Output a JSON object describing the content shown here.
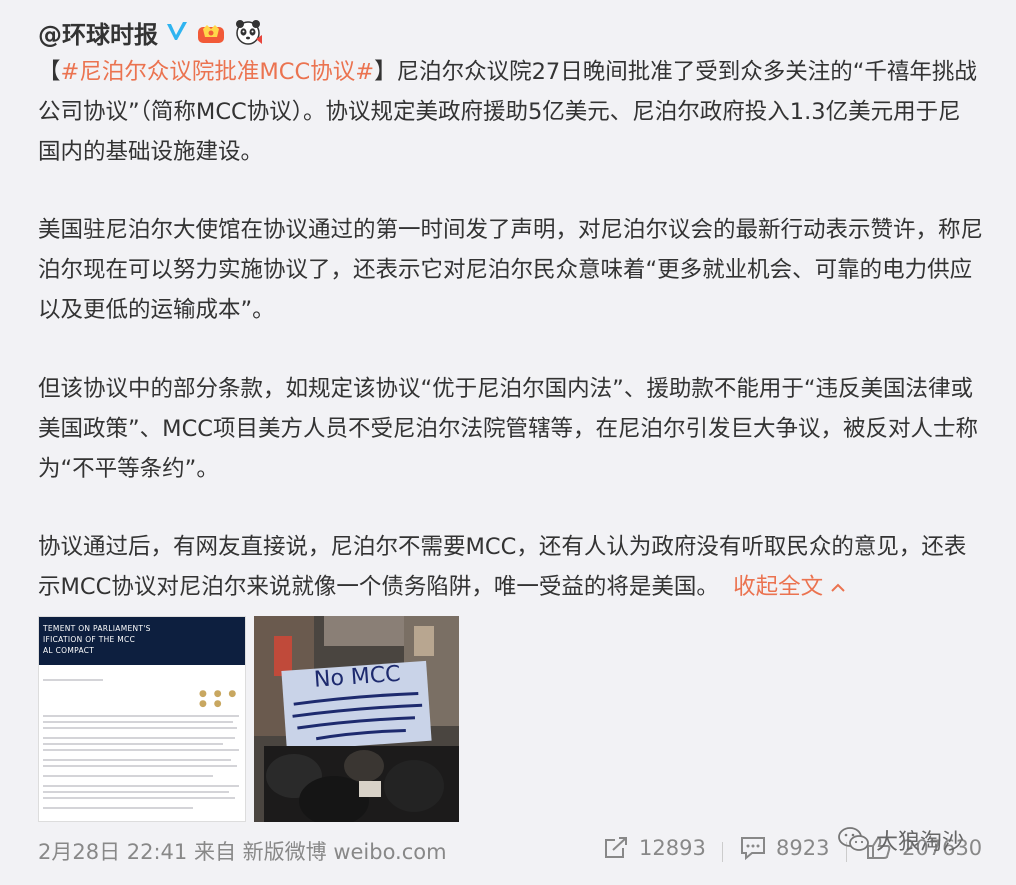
{
  "post": {
    "author": "@环球时报",
    "hashtag_open": "【",
    "hashtag": "#尼泊尔众议院批准MCC协议#",
    "hashtag_close": "】",
    "p1_rest": "尼泊尔众议院27日晚间批准了受到众多关注的“千禧年挑战公司协议”（简称MCC协议）。协议规定美政府援助5亿美元、尼泊尔政府投入1.3亿美元用于尼国内的基础设施建设。",
    "p2": "美国驻尼泊尔大使馆在协议通过的第一时间发了声明，对尼泊尔议会的最新行动表示赞许，称尼泊尔现在可以努力实施协议了，还表示它对尼泊尔民众意味着“更多就业机会、可靠的电力供应以及更低的运输成本”。",
    "p3": "但该协议中的部分条款，如规定该协议“优于尼泊尔国内法”、援助款不能用于“违反美国法律或美国政策”、MCC项目美方人员不受尼泊尔法院管辖等，在尼泊尔引发巨大争议，被反对人士称为“不平等条约”。",
    "p4": "协议通过后，有网友直接说，尼泊尔不需要MCC，还有人认为政府没有听取民众的意见，还表示MCC协议对尼泊尔来说就像一个债务陷阱，唯一受益的将是美国。",
    "collapse_label": "收起全文",
    "collapse_arrow": "^"
  },
  "images": {
    "statement_heading": [
      "TEMENT ON PARLIAMENT'S",
      "IFICATION OF THE MCC",
      "AL COMPACT"
    ],
    "protest_sign_title": "No MCC"
  },
  "footer": {
    "time": "2月28日 22:41",
    "source": "来自 新版微博 weibo.com",
    "reposts": "12893",
    "comments": "8923",
    "likes": "207630",
    "watermark": "大狼淘沙"
  },
  "colors": {
    "link": "#eb7350",
    "verified": "#2fb4f0"
  }
}
